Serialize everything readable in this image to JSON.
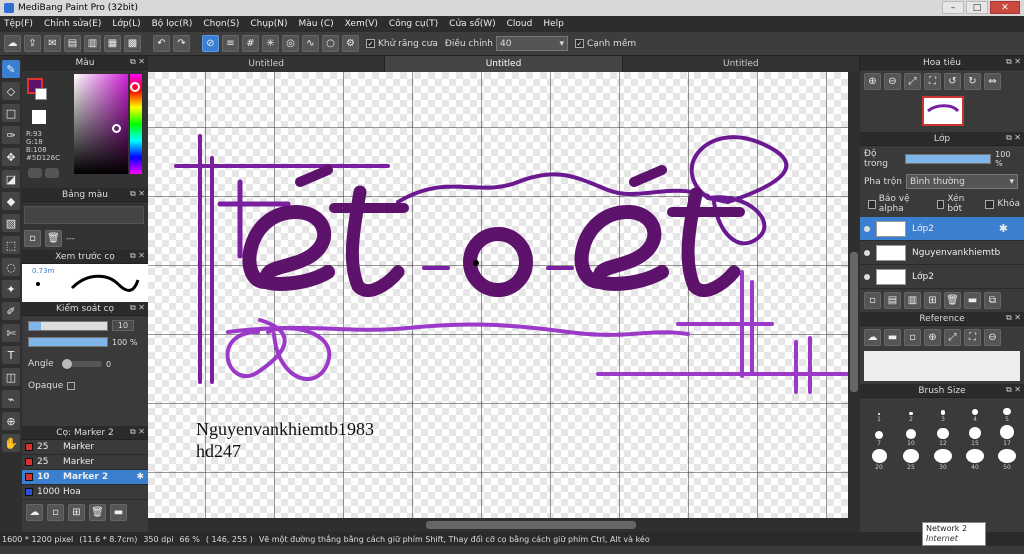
{
  "window": {
    "title": "MediBang Paint Pro (32bit)",
    "min": "–",
    "max": "□",
    "close": "✕"
  },
  "menu": [
    "Tệp(F)",
    "Chỉnh sửa(E)",
    "Lớp(L)",
    "Bộ lọc(R)",
    "Chọn(S)",
    "Chụp(N)",
    "Màu (C)",
    "Xem(V)",
    "Công cụ(T)",
    "Cửa sổ(W)",
    "Cloud",
    "Help"
  ],
  "toolbar": {
    "antialias_label": "Khử răng cưa",
    "adjust_label": "Điều chỉnh",
    "adjust_value": "40",
    "edge_label": "Cạnh mềm"
  },
  "tabs": [
    "Untitled",
    "Untitled",
    "Untitled"
  ],
  "color_panel": {
    "title": "Màu",
    "r": "R:93",
    "g": "G:18",
    "b": "B:108",
    "hex": "#5D126C",
    "current": "#5D126C"
  },
  "palette_panel": {
    "title": "Bảng màu",
    "dash": "---"
  },
  "preview_panel": {
    "title": "Xem trước cọ",
    "size": "0.73m"
  },
  "brush_ctrl": {
    "title": "Kiểm soát cọ",
    "size": "10",
    "opacity": "100 %",
    "opacity_value": 1.0,
    "angle_label": "Angle",
    "angle": "0",
    "opaque_label": "Opaque"
  },
  "brush_list": {
    "title": "Cọ: Marker 2",
    "items": [
      {
        "size": "25",
        "name": "Marker",
        "color": "#d93030"
      },
      {
        "size": "25",
        "name": "Marker",
        "color": "#d93030"
      },
      {
        "size": "10",
        "name": "Marker 2",
        "color": "#d93030"
      },
      {
        "size": "1000",
        "name": "Hoa",
        "color": "#3050d9"
      }
    ]
  },
  "navigator": {
    "title": "Hoa tiêu"
  },
  "layer_panel": {
    "title": "Lớp",
    "opacity_label": "Độ trong",
    "opacity": "100 %",
    "opacity_value": 1.0,
    "blend_label": "Pha trộn",
    "blend": "Bình thường",
    "protect_alpha": "Bảo vệ alpha",
    "clip": "Xén bớt",
    "lock": "Khóa",
    "layers": [
      "Lớp2",
      "Nguyenvankhiemtb",
      "Lớp2"
    ]
  },
  "reference_panel": {
    "title": "Reference"
  },
  "brushsize_panel": {
    "title": "Brush Size",
    "sizes": [
      "1",
      "2",
      "3",
      "4",
      "5",
      "7",
      "10",
      "12",
      "15",
      "17",
      "20",
      "25",
      "30",
      "40",
      "50",
      "70",
      "100"
    ]
  },
  "canvas_text": {
    "signature_line1": "Nguyenvankhiemtb1983",
    "signature_line2": "hd247"
  },
  "status": {
    "size": "1600 * 1200 pixel",
    "cm": "(11.6 * 8.7cm)",
    "dpi": "350 dpi",
    "zoom": "66 %",
    "coords": "( 146, 255 )",
    "hint": "Vẽ một đường thẳng bằng cách giữ phím Shift, Thay đổi cỡ cọ bằng cách giữ phím Ctrl, Alt và kéo"
  },
  "tooltip": {
    "line1": "Network 2",
    "line2": "Internet access"
  },
  "colors": {
    "accent": "#3b7fd1",
    "ink": "#7a1fa0",
    "ink_light": "#b44fd6"
  }
}
